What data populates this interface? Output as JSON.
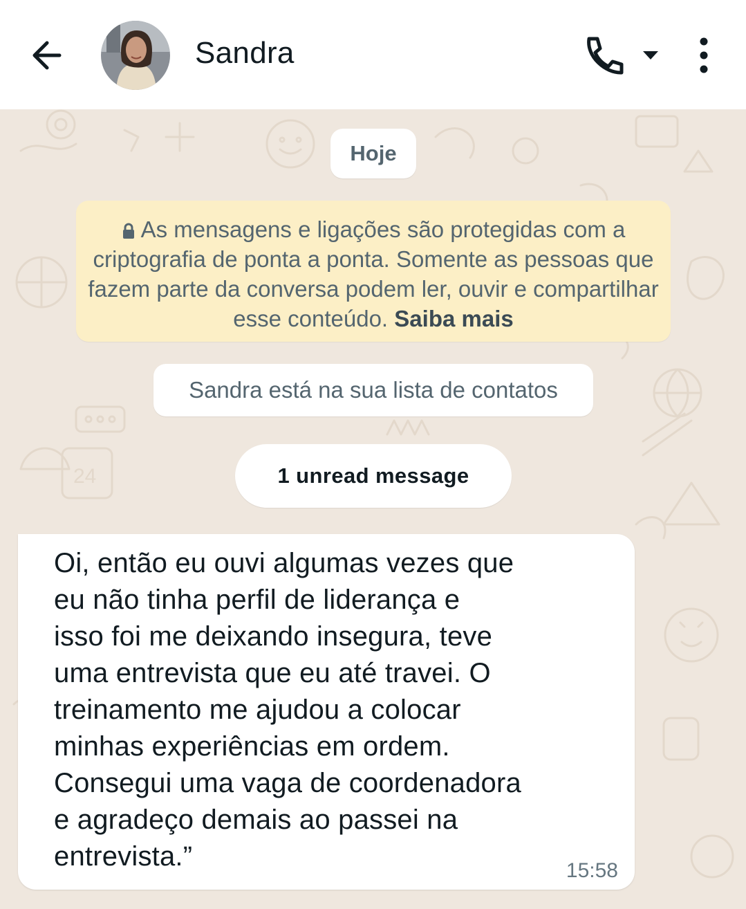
{
  "header": {
    "contact_name": "Sandra"
  },
  "chat": {
    "date_label": "Hoje",
    "encryption_notice": "As mensagens e ligações são protegidas com a criptografia de ponta a ponta. Somente as pessoas que fazem parte da conversa podem ler, ouvir e compartilhar esse conteúdo.",
    "learn_more": "Saiba mais",
    "contact_notice": "Sandra está na sua lista de contatos",
    "unread_label": "1 unread message",
    "message": {
      "text": "Oi, então eu ouvi algumas vezes que\neu não tinha perfil de liderança e\nisso foi me deixando insegura, teve\numa entrevista que eu até travei. O\ntreinamento me ajudou a colocar\nminhas experiências em ordem.\nConsegui uma vaga de coordenadora\ne agradeço demais ao passei na\nentrevista.”",
      "time": "15:58"
    }
  },
  "colors": {
    "header_bg": "#ffffff",
    "chat_bg": "#efe7de",
    "notice_bg": "#fcefc6",
    "bubble_bg": "#ffffff",
    "text_primary": "#111b21",
    "text_secondary": "#54656f"
  },
  "icons": {
    "back": "arrow-left-icon",
    "call": "phone-icon",
    "dropdown": "caret-down-icon",
    "menu": "vertical-dots-icon",
    "lock": "lock-icon"
  }
}
